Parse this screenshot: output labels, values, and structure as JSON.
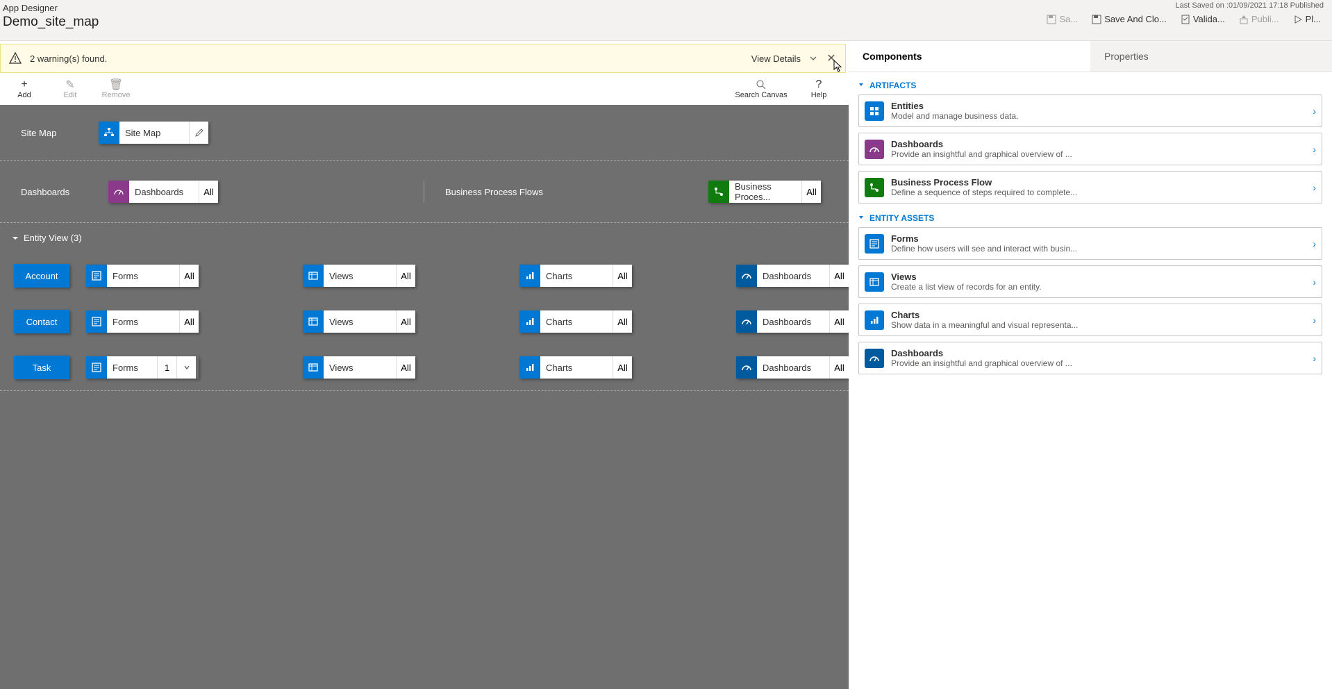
{
  "header": {
    "app_title": "App Designer",
    "app_name": "Demo_site_map",
    "last_saved": "Last Saved on :01/09/2021 17:18 Published",
    "actions": {
      "save": "Sa...",
      "save_close": "Save And Clo...",
      "validate": "Valida...",
      "publish": "Publi...",
      "play": "Pl..."
    }
  },
  "warning": {
    "text": "2 warning(s) found.",
    "view_details": "View Details"
  },
  "action_bar": {
    "add": "Add",
    "edit": "Edit",
    "remove": "Remove",
    "search": "Search Canvas",
    "help": "Help"
  },
  "canvas": {
    "sitemap_label": "Site Map",
    "sitemap_tile": "Site Map",
    "dashboards_label": "Dashboards",
    "dashboards_tile": "Dashboards",
    "dashboards_count": "All",
    "bpf_label": "Business Process Flows",
    "bpf_tile": "Business Proces...",
    "bpf_count": "All",
    "entity_header": "Entity View (3)",
    "entities": [
      {
        "name": "Account",
        "forms": "Forms",
        "forms_ct": "All",
        "views": "Views",
        "views_ct": "All",
        "charts": "Charts",
        "charts_ct": "All",
        "dash": "Dashboards",
        "dash_ct": "All",
        "forms_special": false
      },
      {
        "name": "Contact",
        "forms": "Forms",
        "forms_ct": "All",
        "views": "Views",
        "views_ct": "All",
        "charts": "Charts",
        "charts_ct": "All",
        "dash": "Dashboards",
        "dash_ct": "All",
        "forms_special": false
      },
      {
        "name": "Task",
        "forms": "Forms",
        "forms_ct": "1",
        "views": "Views",
        "views_ct": "All",
        "charts": "Charts",
        "charts_ct": "All",
        "dash": "Dashboards",
        "dash_ct": "All",
        "forms_special": true
      }
    ]
  },
  "side": {
    "tabs": {
      "components": "Components",
      "properties": "Properties"
    },
    "artifacts_hdr": "ARTIFACTS",
    "entity_assets_hdr": "ENTITY ASSETS",
    "artifacts": [
      {
        "title": "Entities",
        "desc": "Model and manage business data.",
        "color": "#0078d4",
        "ic": "grid"
      },
      {
        "title": "Dashboards",
        "desc": "Provide an insightful and graphical overview of ...",
        "color": "#8b3a8b",
        "ic": "gauge"
      },
      {
        "title": "Business Process Flow",
        "desc": "Define a sequence of steps required to complete...",
        "color": "#107c10",
        "ic": "flow"
      }
    ],
    "assets": [
      {
        "title": "Forms",
        "desc": "Define how users will see and interact with busin...",
        "color": "#0078d4",
        "ic": "form"
      },
      {
        "title": "Views",
        "desc": "Create a list view of records for an entity.",
        "color": "#0078d4",
        "ic": "view"
      },
      {
        "title": "Charts",
        "desc": "Show data in a meaningful and visual representa...",
        "color": "#0078d4",
        "ic": "chart"
      },
      {
        "title": "Dashboards",
        "desc": "Provide an insightful and graphical overview of ...",
        "color": "#005a9e",
        "ic": "gauge"
      }
    ]
  }
}
